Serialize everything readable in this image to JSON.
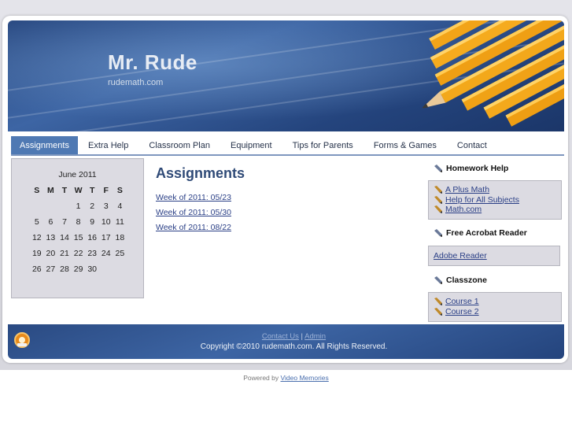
{
  "header": {
    "title": "Mr. Rude",
    "subtitle": "rudemath.com"
  },
  "nav": {
    "items": [
      {
        "label": "Assignments",
        "active": true
      },
      {
        "label": "Extra Help"
      },
      {
        "label": "Classroom Plan"
      },
      {
        "label": "Equipment"
      },
      {
        "label": "Tips for Parents"
      },
      {
        "label": "Forms & Games"
      },
      {
        "label": "Contact"
      }
    ]
  },
  "calendar": {
    "month_label": "June 2011",
    "day_headers": [
      "S",
      "M",
      "T",
      "W",
      "T",
      "F",
      "S"
    ],
    "weeks": [
      [
        "",
        "",
        "",
        "1",
        "2",
        "3",
        "4"
      ],
      [
        "5",
        "6",
        "7",
        "8",
        "9",
        "10",
        "11"
      ],
      [
        "12",
        "13",
        "14",
        "15",
        "16",
        "17",
        "18"
      ],
      [
        "19",
        "20",
        "21",
        "22",
        "23",
        "24",
        "25"
      ],
      [
        "26",
        "27",
        "28",
        "29",
        "30",
        "",
        ""
      ]
    ]
  },
  "main": {
    "title": "Assignments",
    "links": [
      "Week of 2011: 05/23",
      "Week of 2011: 05/30",
      "Week of 2011: 08/22"
    ]
  },
  "sidebar": {
    "sections": [
      {
        "heading": "Homework Help",
        "links": [
          "A Plus Math",
          "Help for All Subjects",
          "Math.com"
        ]
      },
      {
        "heading": "Free Acrobat Reader",
        "links": [
          "Adobe Reader"
        ]
      },
      {
        "heading": "Classzone",
        "links": [
          "Course 1",
          "Course 2"
        ]
      }
    ]
  },
  "footer": {
    "contact_link": "Contact Us",
    "separator": "|",
    "admin_link": "Admin",
    "copyright": "Copyright ©2010 rudemath.com. All Rights Reserved."
  },
  "powered": {
    "prefix": "Powered by",
    "link": "Video Memories"
  },
  "colors": {
    "header_blue": "#2a4a82",
    "nav_active": "#4f79b3",
    "link": "#2a3f86",
    "panel": "#dcdbe2"
  }
}
